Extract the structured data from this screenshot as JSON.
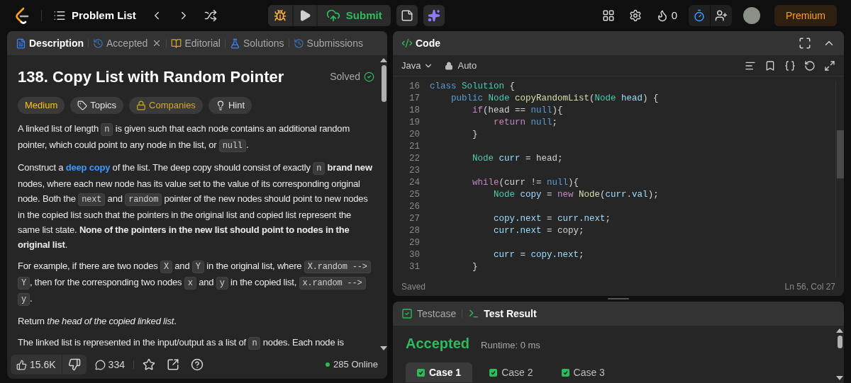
{
  "topbar": {
    "nav_title": "Problem List",
    "submit": "Submit",
    "streak": "0",
    "premium": "Premium"
  },
  "description_tabs": [
    {
      "label": "Description",
      "kind": "description",
      "selected": true
    },
    {
      "label": "Accepted",
      "kind": "accepted",
      "selected": false
    },
    {
      "label": "Editorial",
      "kind": "editorial",
      "selected": false
    },
    {
      "label": "Solutions",
      "kind": "solutions",
      "selected": false
    },
    {
      "label": "Submissions",
      "kind": "submissions",
      "selected": false
    }
  ],
  "problem": {
    "title": "138. Copy List with Random Pointer",
    "status": "Solved",
    "tags": [
      {
        "label": "Medium",
        "kind": "difficulty"
      },
      {
        "label": "Topics",
        "kind": "topics"
      },
      {
        "label": "Companies",
        "kind": "companies"
      },
      {
        "label": "Hint",
        "kind": "hint"
      }
    ],
    "paragraphs": [
      [
        {
          "kind": "text",
          "text": "A linked list of length "
        },
        {
          "kind": "code",
          "text": "n"
        },
        {
          "kind": "text",
          "text": " is given such that each node contains an additional random pointer, which could point to any node in the list, or "
        },
        {
          "kind": "code",
          "text": "null"
        },
        {
          "kind": "text",
          "text": "."
        }
      ],
      [
        {
          "kind": "text",
          "text": "Construct a "
        },
        {
          "kind": "link",
          "text": "deep copy"
        },
        {
          "kind": "text",
          "text": " of the list. The deep copy should consist of exactly "
        },
        {
          "kind": "code",
          "text": "n"
        },
        {
          "kind": "text",
          "text": " **brand new** nodes, where each new node has its value set to the value of its corresponding original node. Both the "
        },
        {
          "kind": "code",
          "text": "next"
        },
        {
          "kind": "text",
          "text": " and "
        },
        {
          "kind": "code",
          "text": "random"
        },
        {
          "kind": "text",
          "text": " pointer of the new nodes should point to new nodes in the copied list such that the pointers in the original list and copied list represent the same list state. **None of the pointers in the new list should point to nodes in the original list**."
        }
      ],
      [
        {
          "kind": "text",
          "text": "For example, if there are two nodes "
        },
        {
          "kind": "code",
          "text": "X"
        },
        {
          "kind": "text",
          "text": " and "
        },
        {
          "kind": "code",
          "text": "Y"
        },
        {
          "kind": "text",
          "text": " in the original list, where "
        },
        {
          "kind": "code",
          "text": "X.random --> Y"
        },
        {
          "kind": "text",
          "text": ", then for the corresponding two nodes "
        },
        {
          "kind": "code",
          "text": "x"
        },
        {
          "kind": "text",
          "text": " and "
        },
        {
          "kind": "code",
          "text": "y"
        },
        {
          "kind": "text",
          "text": " in the copied list, "
        },
        {
          "kind": "code",
          "text": "x.random --> y"
        },
        {
          "kind": "text",
          "text": "."
        }
      ],
      [
        {
          "kind": "text",
          "text": "Return *the head of the copied linked list*."
        }
      ],
      [
        {
          "kind": "text",
          "text": "The linked list is represented in the input/output as a list of "
        },
        {
          "kind": "code",
          "text": "n"
        },
        {
          "kind": "text",
          "text": " nodes. Each node is"
        }
      ]
    ]
  },
  "footer": {
    "likes": "15.6K",
    "comments": "334",
    "online": "285 Online"
  },
  "code_panel": {
    "title": "Code",
    "language": "Java",
    "mode": "Auto",
    "lines": [
      {
        "number": "16",
        "tokens": [
          {
            "text": "class ",
            "kind": "kw"
          },
          {
            "text": "Solution",
            "kind": "type"
          },
          {
            "text": " {",
            "kind": "plain"
          }
        ]
      },
      {
        "number": "17",
        "tokens": [
          {
            "text": "    public ",
            "kind": "kw"
          },
          {
            "text": "Node ",
            "kind": "type"
          },
          {
            "text": "copyRandomList",
            "kind": "fn"
          },
          {
            "text": "(",
            "kind": "plain"
          },
          {
            "text": "Node ",
            "kind": "type"
          },
          {
            "text": "head",
            "kind": "var"
          },
          {
            "text": ") {",
            "kind": "plain"
          }
        ]
      },
      {
        "number": "18",
        "tokens": [
          {
            "text": "        if",
            "kind": "ctl"
          },
          {
            "text": "(head == ",
            "kind": "plain"
          },
          {
            "text": "null",
            "kind": "kw"
          },
          {
            "text": "){",
            "kind": "plain"
          }
        ]
      },
      {
        "number": "19",
        "tokens": [
          {
            "text": "            return ",
            "kind": "ctl"
          },
          {
            "text": "null",
            "kind": "kw"
          },
          {
            "text": ";",
            "kind": "plain"
          }
        ]
      },
      {
        "number": "20",
        "tokens": [
          {
            "text": "        }",
            "kind": "plain"
          }
        ]
      },
      {
        "number": "21"
      },
      {
        "number": "22",
        "tokens": [
          {
            "text": "        Node ",
            "kind": "type"
          },
          {
            "text": "curr",
            "kind": "var"
          },
          {
            "text": " = head;",
            "kind": "plain"
          }
        ]
      },
      {
        "number": "23"
      },
      {
        "number": "24",
        "tokens": [
          {
            "text": "        while",
            "kind": "ctl"
          },
          {
            "text": "(curr != ",
            "kind": "plain"
          },
          {
            "text": "null",
            "kind": "kw"
          },
          {
            "text": "){",
            "kind": "plain"
          }
        ]
      },
      {
        "number": "25",
        "tokens": [
          {
            "text": "            Node ",
            "kind": "type"
          },
          {
            "text": "copy",
            "kind": "var"
          },
          {
            "text": " = ",
            "kind": "plain"
          },
          {
            "text": "new ",
            "kind": "ctl"
          },
          {
            "text": "Node",
            "kind": "fn"
          },
          {
            "text": "(",
            "kind": "plain"
          },
          {
            "text": "curr.val",
            "kind": "var"
          },
          {
            "text": ");",
            "kind": "plain"
          }
        ]
      },
      {
        "number": "26"
      },
      {
        "number": "27",
        "tokens": [
          {
            "text": "            copy.next",
            "kind": "var"
          },
          {
            "text": " = ",
            "kind": "plain"
          },
          {
            "text": "curr.next",
            "kind": "var"
          },
          {
            "text": ";",
            "kind": "plain"
          }
        ]
      },
      {
        "number": "28",
        "tokens": [
          {
            "text": "            curr.next",
            "kind": "var"
          },
          {
            "text": " = copy;",
            "kind": "plain"
          }
        ]
      },
      {
        "number": "29"
      },
      {
        "number": "30",
        "tokens": [
          {
            "text": "            curr",
            "kind": "var"
          },
          {
            "text": " = ",
            "kind": "plain"
          },
          {
            "text": "copy.next",
            "kind": "var"
          },
          {
            "text": ";",
            "kind": "plain"
          }
        ]
      },
      {
        "number": "31",
        "tokens": [
          {
            "text": "        }",
            "kind": "plain"
          }
        ]
      }
    ],
    "save_status": "Saved",
    "cursor": "Ln 56, Col 27"
  },
  "result_panel": {
    "tabs": [
      {
        "label": "Testcase",
        "kind": "testcase",
        "selected": false
      },
      {
        "label": "Test Result",
        "kind": "result",
        "selected": true
      }
    ],
    "verdict": "Accepted",
    "runtime": "Runtime: 0 ms",
    "cases": [
      {
        "label": "Case 1",
        "selected": true
      },
      {
        "label": "Case 2",
        "selected": false
      },
      {
        "label": "Case 3",
        "selected": false
      }
    ]
  }
}
